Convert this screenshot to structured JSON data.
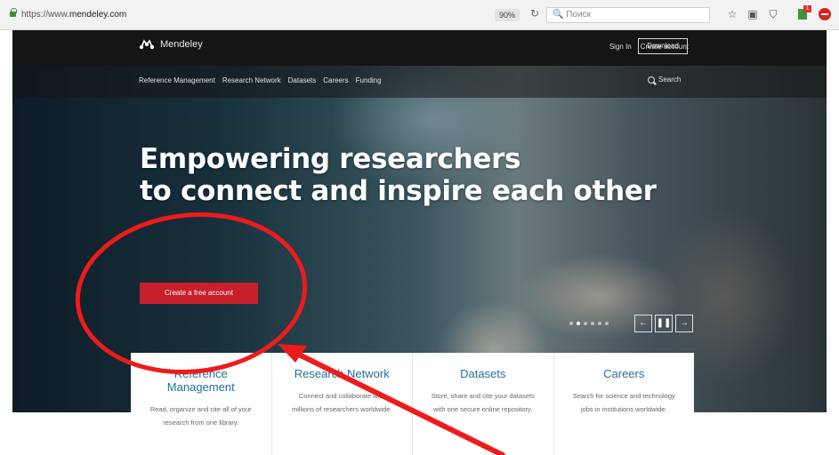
{
  "browser": {
    "url_prefix": "https://www.",
    "url_domain": "mendeley.com",
    "zoom": "90%",
    "search_placeholder": "Поиск"
  },
  "site": {
    "logo_text": "Mendeley",
    "sign_in": "Sign In",
    "create_account": "Create account",
    "download": "Download",
    "nav": [
      "Reference Management",
      "Research Network",
      "Datasets",
      "Careers",
      "Funding"
    ],
    "search_label": "Search",
    "headline_line1": "Empowering researchers",
    "headline_line2": "to connect and inspire each other",
    "cta": "Create a free account",
    "slider": {
      "dot_count": 6,
      "active_index": 1,
      "prev": "←",
      "pause": "❚❚",
      "next": "→"
    }
  },
  "cards": [
    {
      "title": "Reference Management",
      "text": "Read, organize and cite all of your research from one library."
    },
    {
      "title": "Research Network",
      "text": "Connect and collaborate with millions of researchers worldwide."
    },
    {
      "title": "Datasets",
      "text": "Store, share and cite your datasets with one secure online repository."
    },
    {
      "title": "Careers",
      "text": "Search for science and technology jobs in institutions worldwide."
    }
  ],
  "annotation": {
    "color": "#ee1b1b",
    "shape": "ellipse-around-cta-with-arrow"
  }
}
